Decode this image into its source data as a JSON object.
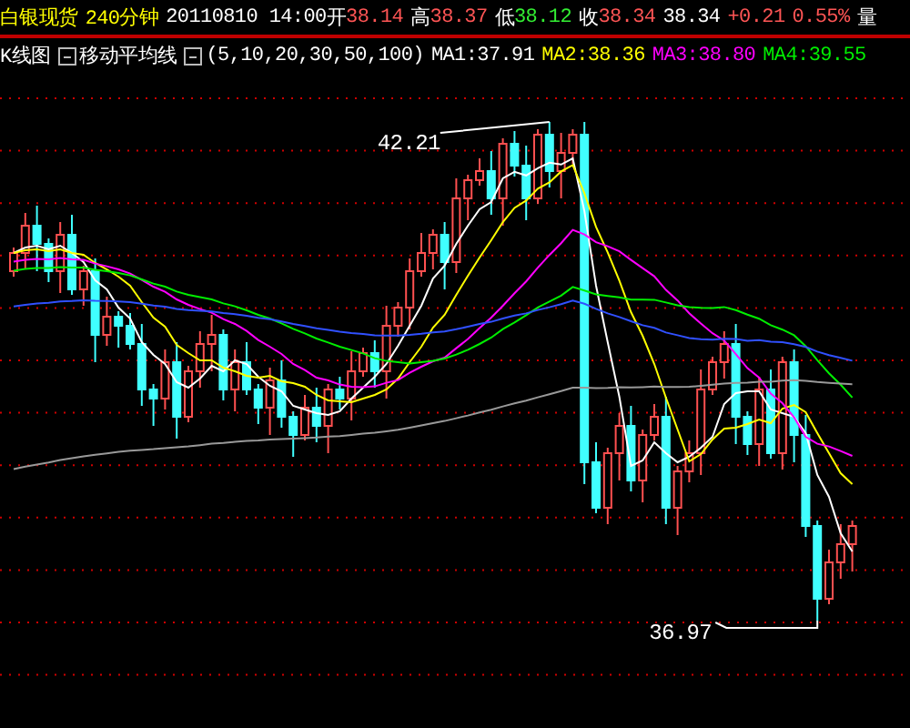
{
  "header": {
    "instrument": "白银现货",
    "period": "240分钟",
    "datetime": "20110810 14:00",
    "quotes": [
      {
        "label": "开",
        "value": "38.14",
        "color": "#ff5555"
      },
      {
        "label": "高",
        "value": "38.37",
        "color": "#ff5555"
      },
      {
        "label": "低",
        "value": "38.12",
        "color": "#33ee33"
      },
      {
        "label": "收",
        "value": "38.34",
        "color": "#ff5555"
      }
    ],
    "last": "38.34",
    "change": "+0.21",
    "change_pct": "0.55%",
    "volume_label": "量"
  },
  "indicator_bar": {
    "chart_type": "K线图",
    "indicator": "移动平均线",
    "params": "(5,10,20,30,50,100)",
    "ma": [
      {
        "label": "MA1:37.91",
        "color": "#ffffff"
      },
      {
        "label": "MA2:38.36",
        "color": "#ffff00"
      },
      {
        "label": "MA3:38.80",
        "color": "#ff00ff"
      },
      {
        "label": "MA4:39.55",
        "color": "#00ee00"
      }
    ]
  },
  "chart": {
    "high_label": "42.21",
    "low_label": "36.97"
  }
}
